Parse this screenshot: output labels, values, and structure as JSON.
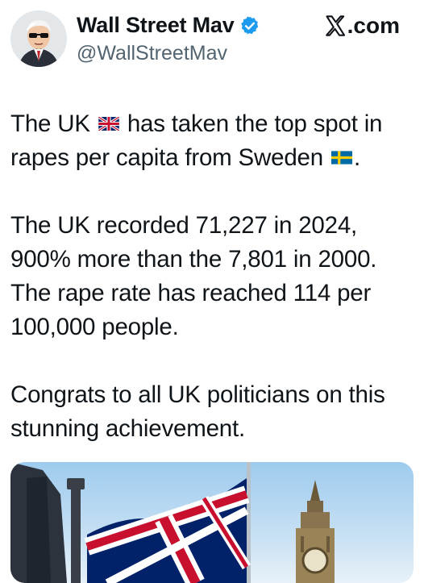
{
  "author": {
    "display_name": "Wall Street Mav",
    "handle": "@WallStreetMav",
    "verified": true,
    "avatar_icon": "suited-man-with-sunglasses-avatar"
  },
  "brand": {
    "label": ".com",
    "logo_icon": "x-logo-icon"
  },
  "post": {
    "line1_prefix": "The UK",
    "line1_suffix": "has taken the top spot in",
    "line2_prefix": "rapes per capita from Sweden",
    "line2_suffix": ".",
    "flag_uk": "uk-flag-icon",
    "flag_se": "sweden-flag-icon",
    "para2": "The UK recorded 71,227 in 2024, 900% more than the 7,801 in 2000. The rape rate has reached 114 per 100,000 people.",
    "para3": "Congrats to all UK politicians on this stunning achievement."
  },
  "media": {
    "description_icons": [
      "union-jack-flag-icon",
      "big-ben-tower-icon"
    ]
  },
  "colors": {
    "verified_blue": "#1d9bf0",
    "text": "#0f1419",
    "muted": "#536471"
  }
}
